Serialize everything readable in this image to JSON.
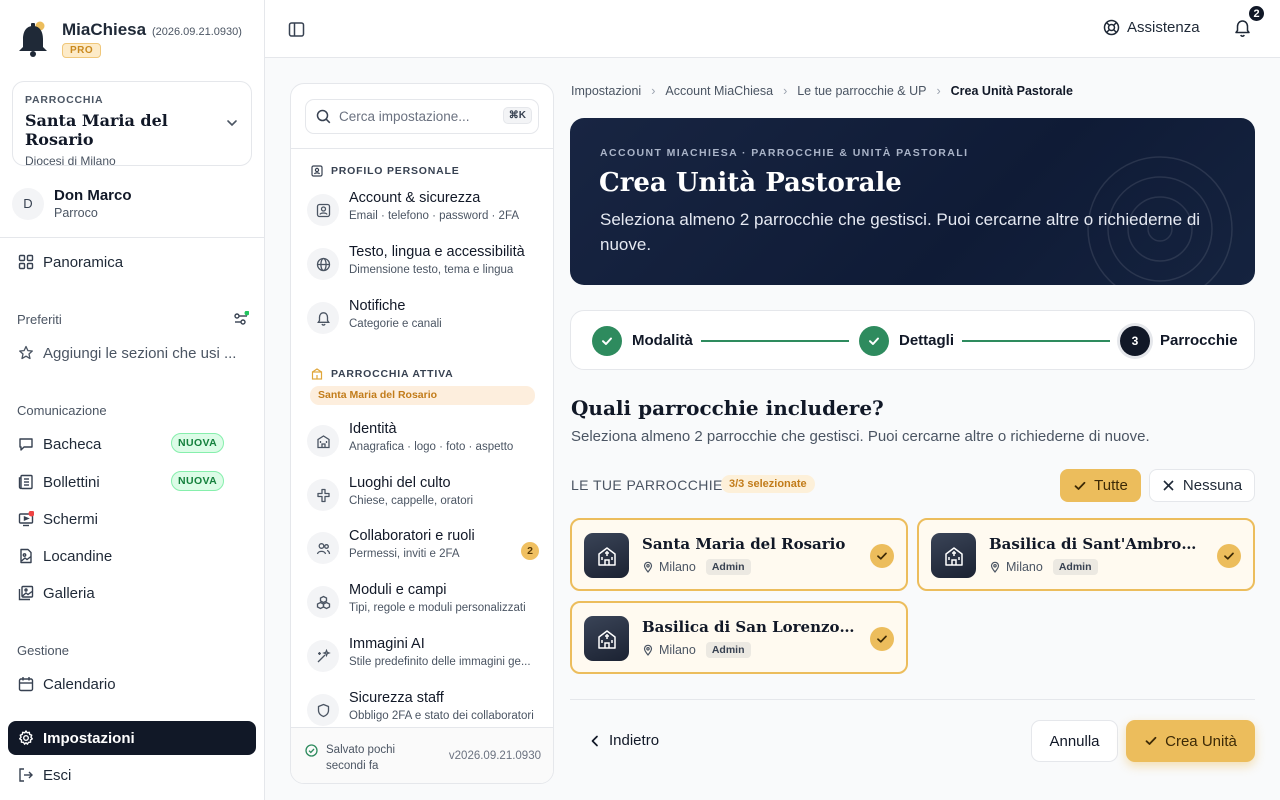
{
  "brand": {
    "name": "MiaChiesa",
    "version": "(2026.09.21.0930)",
    "plan": "PRO"
  },
  "parish": {
    "eyebrow": "PARROCCHIA",
    "name": "Santa Maria del Rosario",
    "diocese": "Diocesi di Milano"
  },
  "user": {
    "initial": "D",
    "name": "Don Marco",
    "role": "Parroco"
  },
  "nav": {
    "overview": "Panoramica",
    "favorites_label": "Preferiti",
    "favorites_add": "Aggiungi le sezioni che usi ...",
    "comm_label": "Comunicazione",
    "board": "Bacheca",
    "bulletins": "Bollettini",
    "screens": "Schermi",
    "posters": "Locandine",
    "gallery": "Galleria",
    "new_badge": "NUOVA",
    "mgmt_label": "Gestione",
    "calendar": "Calendario",
    "settings": "Impostazioni",
    "logout": "Esci"
  },
  "topbar": {
    "help": "Assistenza",
    "notifications_count": "2"
  },
  "settings_panel": {
    "search_placeholder": "Cerca impostazione...",
    "shortcut": "⌘K",
    "personal_section": "PROFILO PERSONALE",
    "active_section": "PARROCCHIA ATTIVA",
    "active_parish": "Santa Maria del Rosario",
    "items": [
      {
        "title": "Account & sicurezza",
        "desc": "Email · telefono · password · 2FA"
      },
      {
        "title": "Testo, lingua e accessibilità",
        "desc": "Dimensione testo, tema e lingua"
      },
      {
        "title": "Notifiche",
        "desc": "Categorie e canali"
      },
      {
        "title": "Identità",
        "desc": "Anagrafica · logo · foto · aspetto"
      },
      {
        "title": "Luoghi del culto",
        "desc": "Chiese, cappelle, oratori"
      },
      {
        "title": "Collaboratori e ruoli",
        "desc": "Permessi, inviti e 2FA",
        "badge": "2"
      },
      {
        "title": "Moduli e campi",
        "desc": "Tipi, regole e moduli personalizzati"
      },
      {
        "title": "Immagini AI",
        "desc": "Stile predefinito delle immagini ge..."
      },
      {
        "title": "Sicurezza staff",
        "desc": "Obbligo 2FA e stato dei collaboratori"
      }
    ],
    "saved_line1": "Salvato pochi",
    "saved_line2": "secondi fa",
    "version": "v2026.09.21.0930"
  },
  "breadcrumb": [
    "Impostazioni",
    "Account MiaChiesa",
    "Le tue parrocchie & UP",
    "Crea Unità Pastorale"
  ],
  "hero": {
    "eyebrow": "ACCOUNT MIACHIESA · PARROCCHIE & UNITÀ PASTORALI",
    "title": "Crea Unità Pastorale",
    "subtitle": "Seleziona almeno 2 parrocchie che gestisci. Puoi cercarne altre o richiederne di nuove."
  },
  "stepper": {
    "steps": [
      {
        "label": "Modalità",
        "state": "done"
      },
      {
        "label": "Dettagli",
        "state": "done"
      },
      {
        "label": "Parrocchie",
        "state": "current",
        "number": "3"
      }
    ],
    "done_color": "#2e8b5e"
  },
  "question": {
    "title": "Quali parrocchie includere?",
    "subtitle": "Seleziona almeno 2 parrocchie che gestisci. Puoi cercarne altre o richiederne di nuove."
  },
  "list": {
    "label": "LE TUE PARROCCHIE",
    "selected_badge": "3/3 selezionate",
    "all_button": "Tutte",
    "none_button": "Nessuna",
    "parishes": [
      {
        "name": "Santa Maria del Rosario",
        "city": "Milano",
        "role": "Admin",
        "selected": true
      },
      {
        "name": "Basilica di Sant'Ambrogio",
        "city": "Milano",
        "role": "Admin",
        "selected": true
      },
      {
        "name": "Basilica di San Lorenzo Mag...",
        "city": "Milano",
        "role": "Admin",
        "selected": true
      }
    ]
  },
  "actions": {
    "back": "Indietro",
    "cancel": "Annulla",
    "create": "Crea Unità"
  },
  "colors": {
    "accent": "#ecbd5c",
    "navy": "#111827",
    "success": "#2e8b5e"
  }
}
